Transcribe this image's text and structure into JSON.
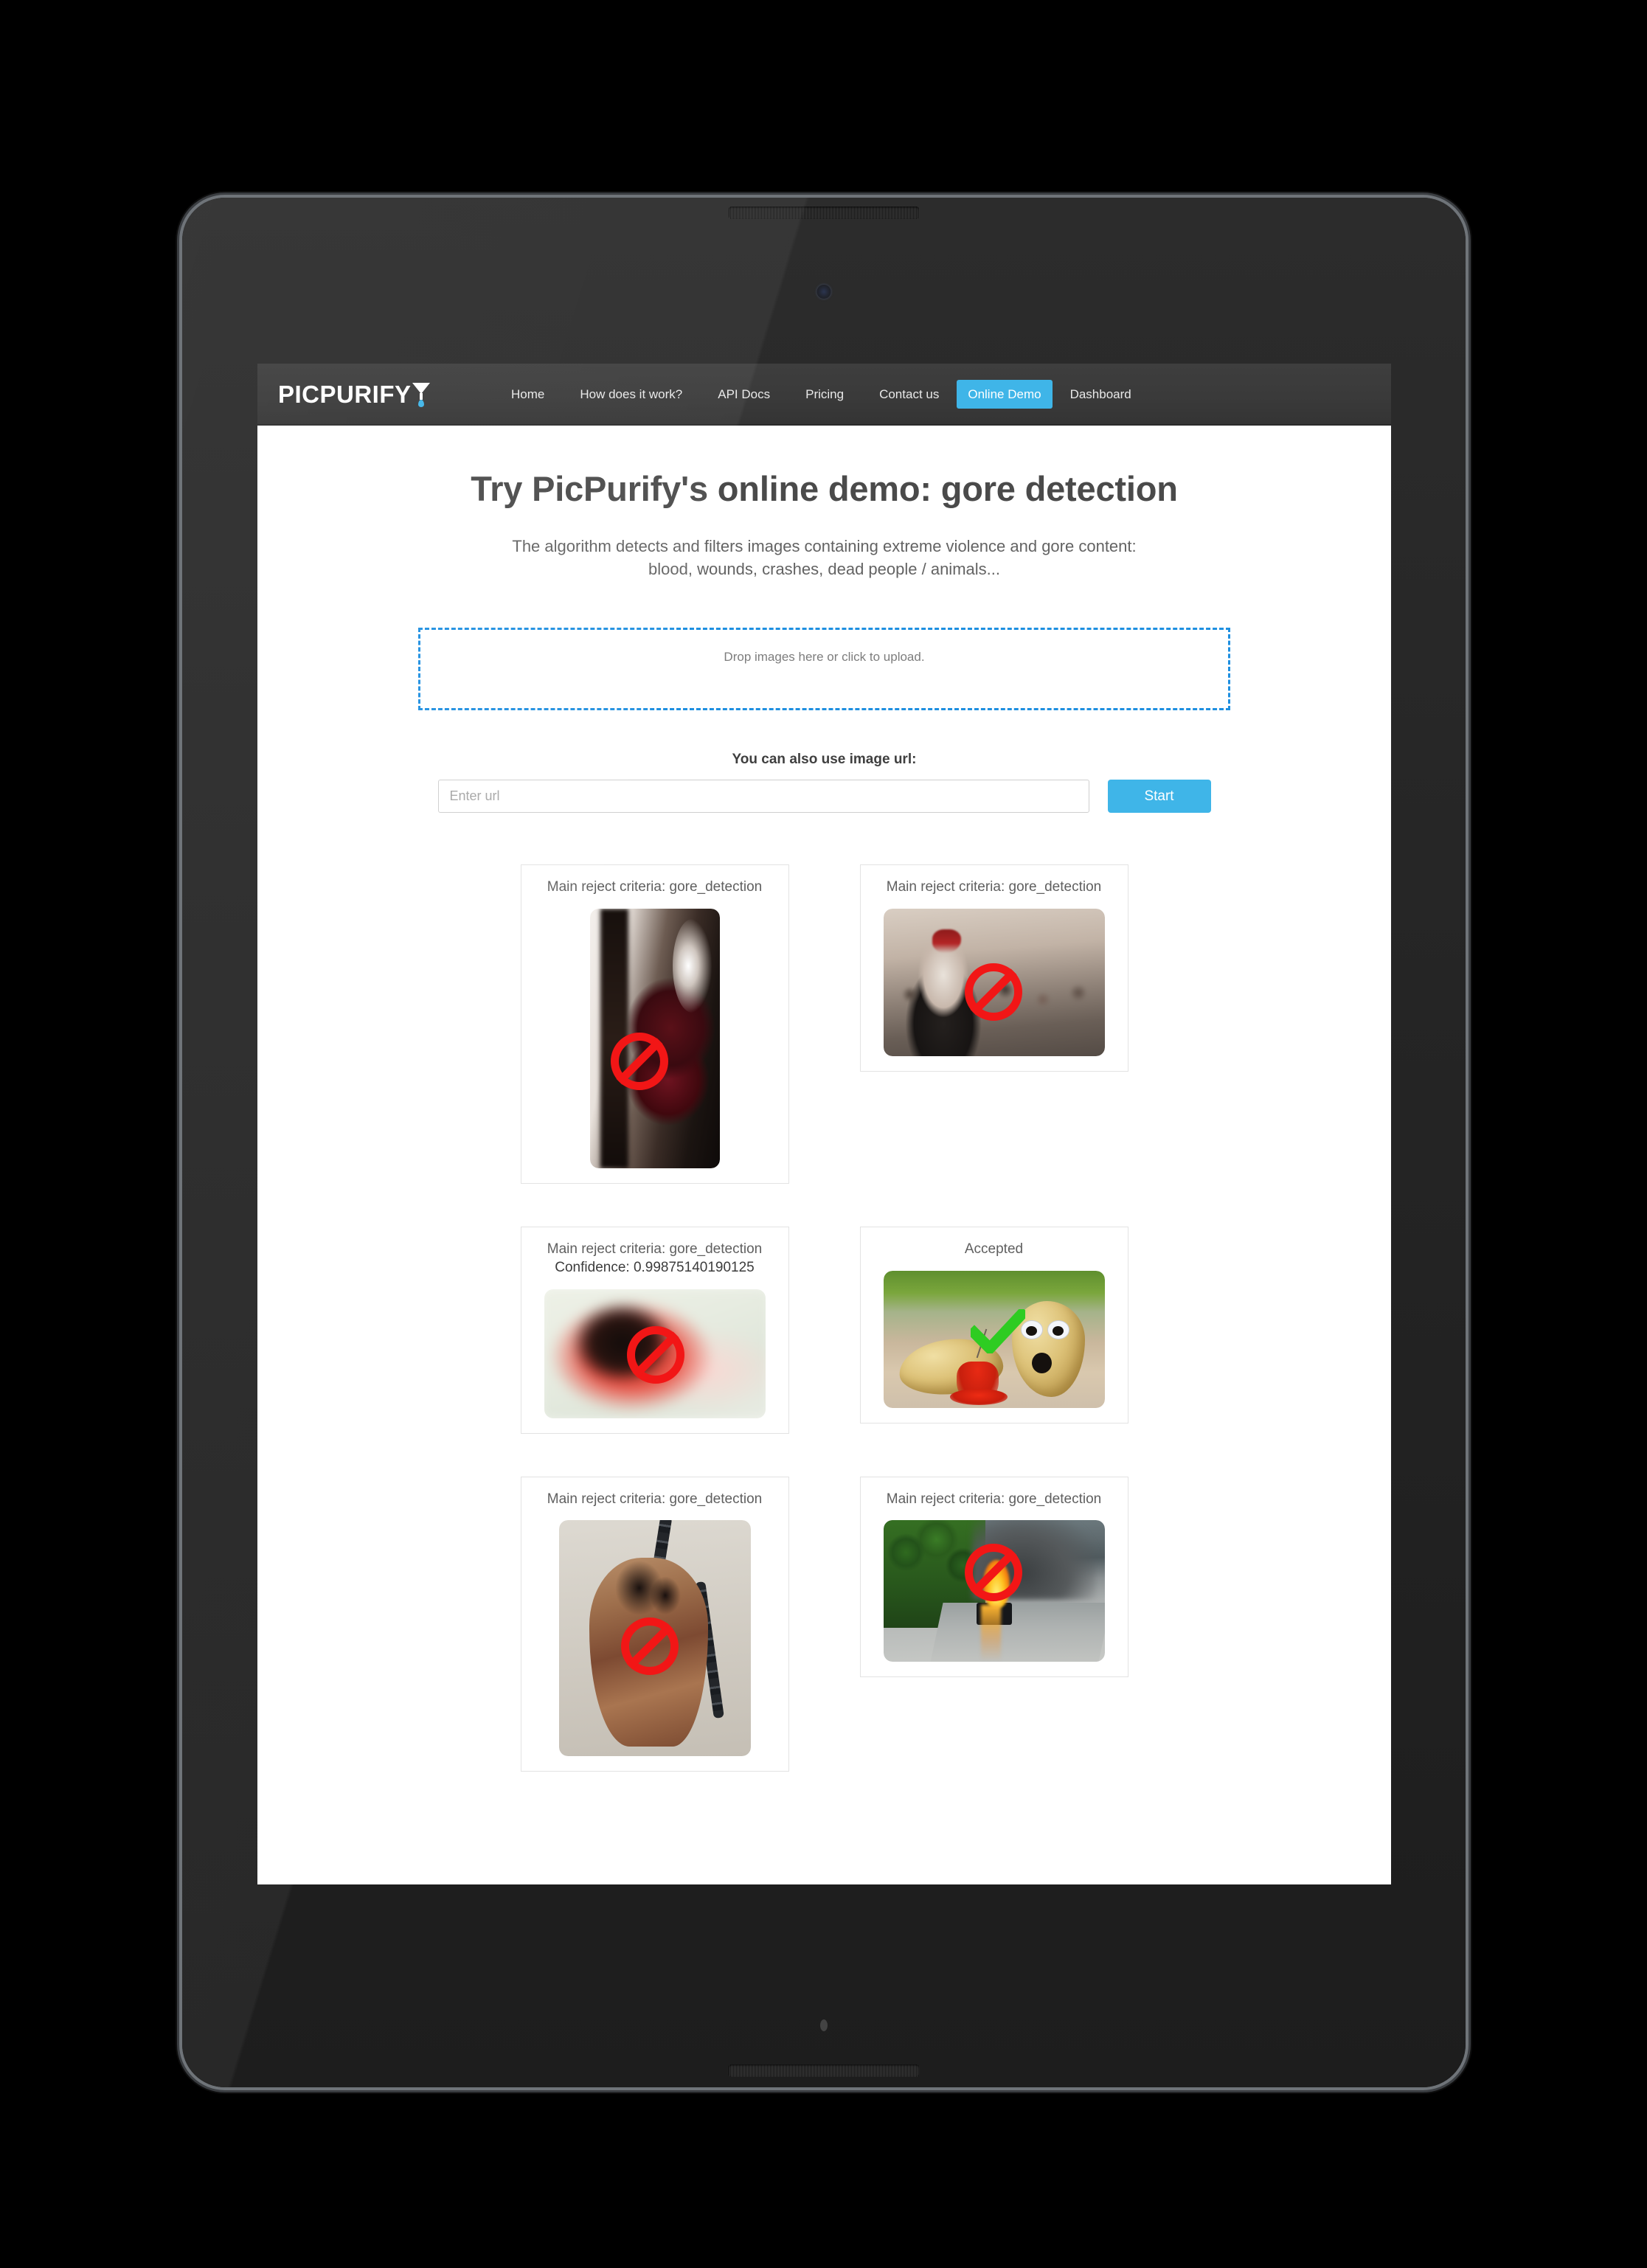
{
  "brand": {
    "name": "PICPURIFY",
    "accent_color": "#3fb5e8"
  },
  "nav": {
    "items": [
      {
        "label": "Home",
        "active": false
      },
      {
        "label": "How does it work?",
        "active": false
      },
      {
        "label": "API Docs",
        "active": false
      },
      {
        "label": "Pricing",
        "active": false
      },
      {
        "label": "Contact us",
        "active": false
      },
      {
        "label": "Online Demo",
        "active": true
      },
      {
        "label": "Dashboard",
        "active": false
      }
    ]
  },
  "hero": {
    "title": "Try PicPurify's online demo:  gore detection",
    "subtitle_line1": "The algorithm detects and filters images containing extreme violence and gore content:",
    "subtitle_line2": "blood, wounds, crashes, dead people / animals..."
  },
  "dropzone": {
    "text": "Drop images here or click to upload."
  },
  "url_form": {
    "label": "You can also use image url:",
    "placeholder": "Enter url",
    "value": "",
    "submit_label": "Start"
  },
  "results": {
    "rows": [
      [
        {
          "caption": "Main reject criteria: gore_detection",
          "confidence": "",
          "status": "rejected",
          "badge": "reject-icon",
          "thumb": "bloody-face-thumb"
        },
        {
          "caption": "Main reject criteria: gore_detection",
          "confidence": "",
          "status": "rejected",
          "badge": "reject-icon",
          "thumb": "zombie-crowd-thumb"
        }
      ],
      [
        {
          "caption": "Main reject criteria: gore_detection",
          "confidence": "Confidence: 0.99875140190125",
          "status": "rejected",
          "badge": "reject-icon",
          "thumb": "blurred-gore-thumb"
        },
        {
          "caption": "Accepted",
          "confidence": "",
          "status": "accepted",
          "badge": "accept-icon",
          "thumb": "potatoes-thumb"
        }
      ],
      [
        {
          "caption": "Main reject criteria: gore_detection",
          "confidence": "",
          "status": "rejected",
          "badge": "reject-icon",
          "thumb": "skull-chain-thumb"
        },
        {
          "caption": "Main reject criteria: gore_detection",
          "confidence": "",
          "status": "rejected",
          "badge": "reject-icon",
          "thumb": "burning-car-thumb"
        }
      ]
    ]
  }
}
